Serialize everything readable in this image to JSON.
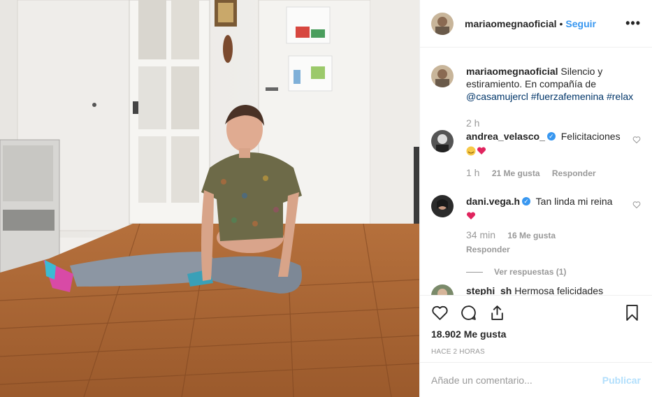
{
  "post": {
    "username": "mariaomegnaoficial",
    "follow_label": "Seguir",
    "more_label": "•••",
    "caption": {
      "username": "mariaomegnaoficial",
      "text": "Silencio y estiramiento. En compañía de",
      "mention": "@casamujercl",
      "hashtags": "#fuerzafemenina #relax",
      "time": "2 h"
    },
    "comments": [
      {
        "username": "andrea_velasco_",
        "text": "Felicitaciones",
        "time": "1 h",
        "likes": "21 Me gusta",
        "reply": "Responder"
      },
      {
        "username": "dani.vega.h",
        "text": "Tan linda mi reina",
        "time": "34 min",
        "likes": "16 Me gusta",
        "reply": "Responder",
        "view_replies": "Ver respuestas (1)"
      },
      {
        "username": "stephi_sh",
        "text": "Hermosa felicidades"
      }
    ],
    "likes_count": "18.902 Me gusta",
    "posted_ago": "HACE 2 HORAS",
    "add_comment_placeholder": "Añade un comentario...",
    "publish_label": "Publicar"
  },
  "icons": {
    "like": "heart-icon",
    "comment": "comment-icon",
    "share": "share-icon",
    "save": "bookmark-icon",
    "verified": "verified-badge-icon"
  },
  "colors": {
    "link": "#3897f0",
    "mention": "#003569",
    "publish_disabled": "#b2dffc"
  }
}
